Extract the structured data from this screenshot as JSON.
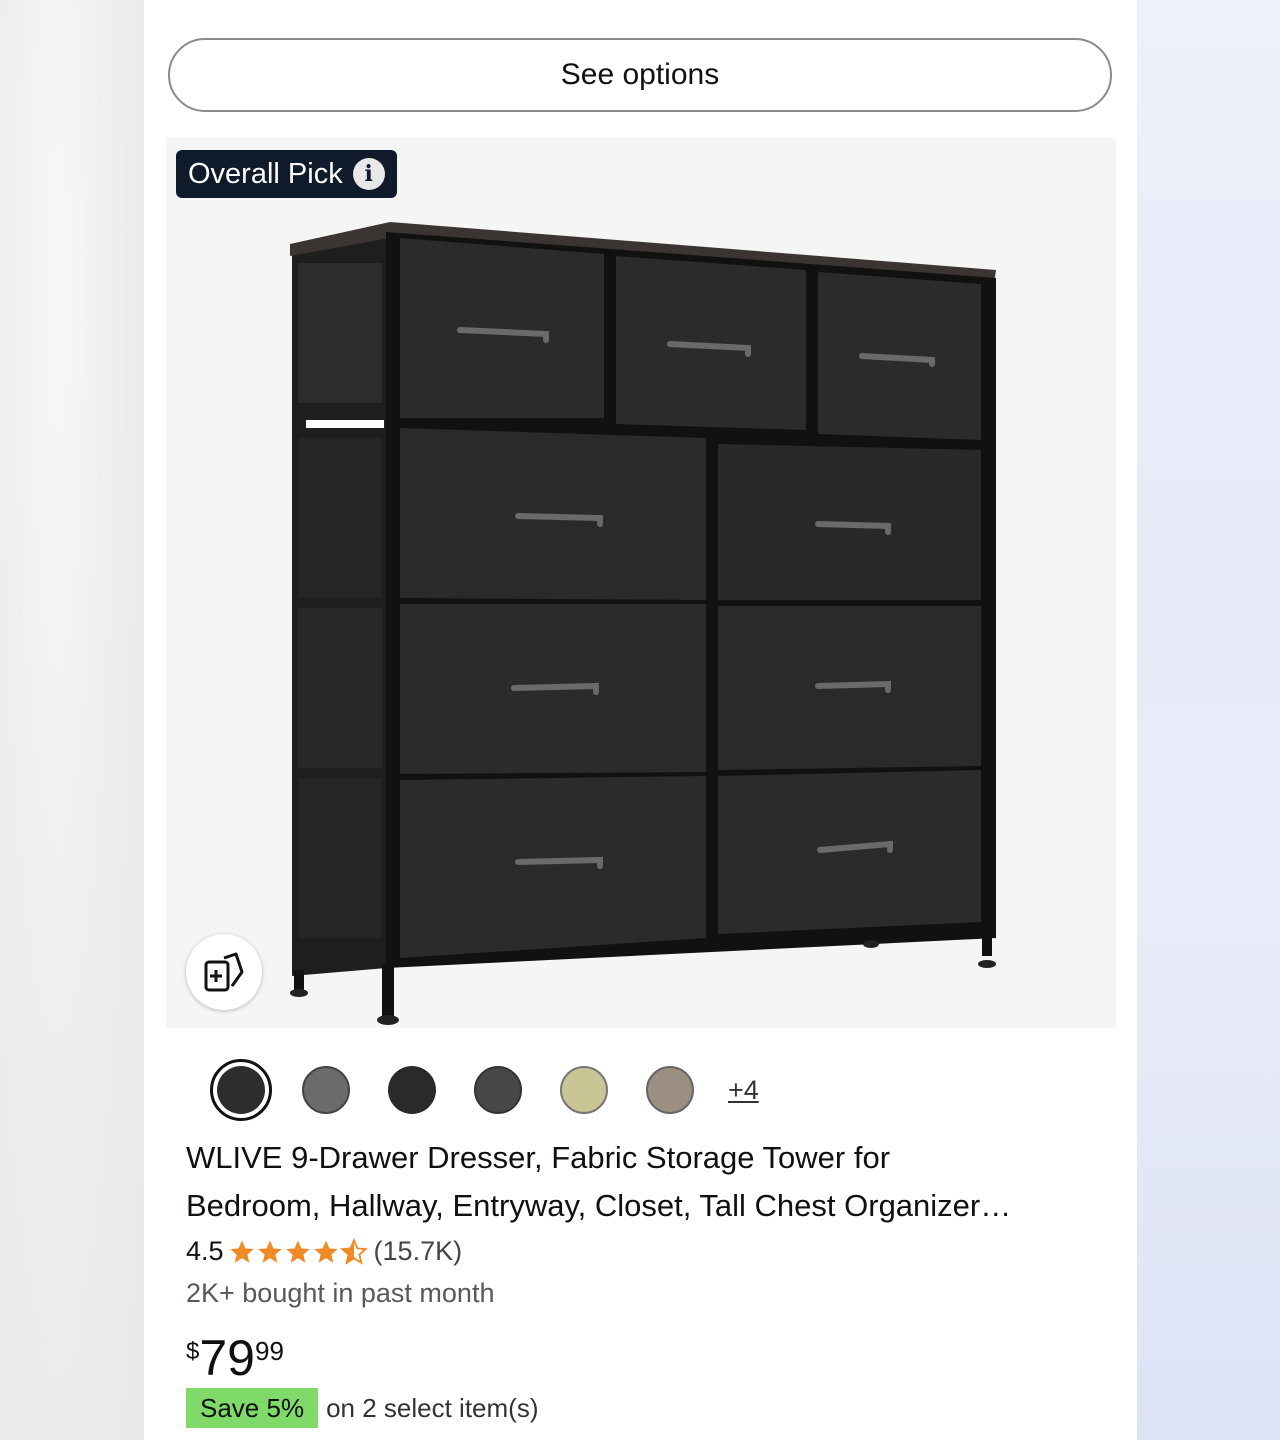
{
  "buttons": {
    "see_options": "See options"
  },
  "product": {
    "badge": "Overall Pick",
    "title_line1": "WLIVE 9-Drawer Dresser, Fabric Storage Tower for",
    "title_line2": "Bedroom, Hallway, Entryway, Closet, Tall Chest Organizer…",
    "rating": "4.5",
    "rating_value": 4.5,
    "review_count": "(15.7K)",
    "bought": "2K+ bought in past month",
    "price_symbol": "$",
    "price_whole": "79",
    "price_fraction": "99",
    "save_badge": "Save 5%",
    "save_text": "on 2 select item(s)",
    "more_swatches": "+4"
  },
  "swatch_colors": [
    "#2d2d2d",
    "#6b6b6b",
    "#2a2a2a",
    "#474747",
    "#c9c595",
    "#9a8f80"
  ],
  "colors": {
    "star": "#f08a24",
    "save_green": "#7fda69",
    "badge_bg": "#0f1a2a"
  }
}
